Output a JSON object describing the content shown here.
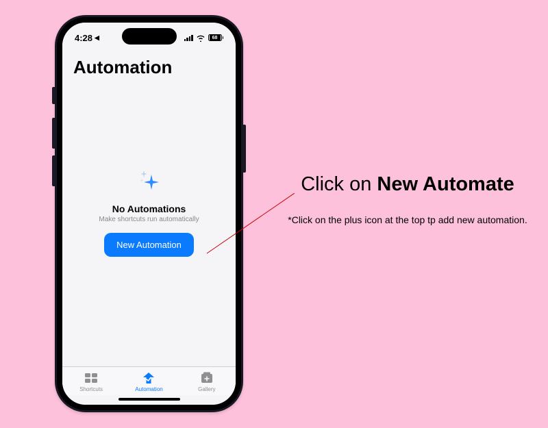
{
  "status": {
    "time": "4:28",
    "location_arrow": "◀",
    "battery_percent": "68"
  },
  "header": {
    "title": "Automation"
  },
  "empty_state": {
    "title": "No Automations",
    "subtitle": "Make shortcuts run automatically",
    "button_label": "New Automation"
  },
  "tabs": {
    "shortcuts": "Shortcuts",
    "automation": "Automation",
    "gallery": "Gallery"
  },
  "instruction": {
    "prefix": "Click on ",
    "bold": "New Automate",
    "note": "*Click on the plus icon at the top tp add new automation."
  }
}
